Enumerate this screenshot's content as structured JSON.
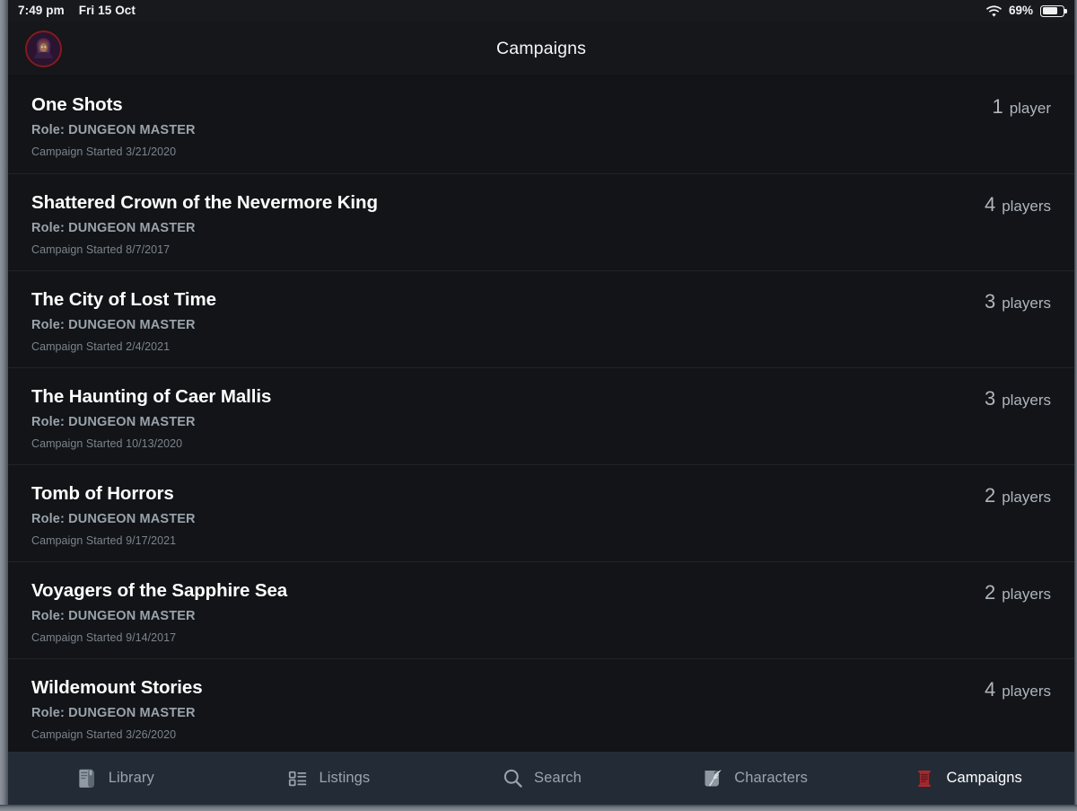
{
  "status_bar": {
    "time": "7:49 pm",
    "date": "Fri 15 Oct",
    "wifi_icon": "wifi-icon",
    "battery_percent": "69%",
    "battery_level": 69
  },
  "header": {
    "title": "Campaigns",
    "avatar_icon": "avatar"
  },
  "campaigns": [
    {
      "title": "One Shots",
      "role": "Role: DUNGEON MASTER",
      "started": "Campaign Started 3/21/2020",
      "players_count": "1",
      "players_label": "player"
    },
    {
      "title": "Shattered Crown of the Nevermore King",
      "role": "Role: DUNGEON MASTER",
      "started": "Campaign Started 8/7/2017",
      "players_count": "4",
      "players_label": "players"
    },
    {
      "title": "The City of Lost Time",
      "role": "Role: DUNGEON MASTER",
      "started": "Campaign Started 2/4/2021",
      "players_count": "3",
      "players_label": "players"
    },
    {
      "title": "The Haunting of Caer Mallis",
      "role": "Role: DUNGEON MASTER",
      "started": "Campaign Started 10/13/2020",
      "players_count": "3",
      "players_label": "players"
    },
    {
      "title": "Tomb of Horrors",
      "role": "Role: DUNGEON MASTER",
      "started": "Campaign Started 9/17/2021",
      "players_count": "2",
      "players_label": "players"
    },
    {
      "title": "Voyagers of the Sapphire Sea",
      "role": "Role: DUNGEON MASTER",
      "started": "Campaign Started 9/14/2017",
      "players_count": "2",
      "players_label": "players"
    },
    {
      "title": "Wildemount Stories",
      "role": "Role: DUNGEON MASTER",
      "started": "Campaign Started 3/26/2020",
      "players_count": "4",
      "players_label": "players"
    }
  ],
  "tab_bar": {
    "active_index": 4,
    "active_color": "#ffffff",
    "inactive_color": "#9aa4ae",
    "campaigns_icon_color": "#b0282d",
    "tabs": [
      {
        "label": "Library",
        "icon": "book-icon"
      },
      {
        "label": "Listings",
        "icon": "list-icon"
      },
      {
        "label": "Search",
        "icon": "search-icon"
      },
      {
        "label": "Characters",
        "icon": "scroll-quill-icon"
      },
      {
        "label": "Campaigns",
        "icon": "scroll-icon"
      }
    ]
  }
}
